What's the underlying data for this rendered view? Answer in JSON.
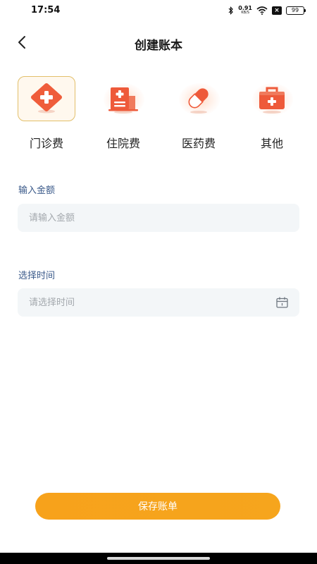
{
  "status_bar": {
    "time": "17:54",
    "net_speed": "0.91",
    "net_unit": "KB/S",
    "battery": "99"
  },
  "header": {
    "title": "创建账本",
    "back_icon": "chevron-left-icon"
  },
  "categories": [
    {
      "label": "门诊费",
      "icon": "medical-cross-icon",
      "selected": true
    },
    {
      "label": "住院费",
      "icon": "hospital-building-icon",
      "selected": false
    },
    {
      "label": "医药费",
      "icon": "pill-capsule-icon",
      "selected": false
    },
    {
      "label": "其他",
      "icon": "first-aid-kit-icon",
      "selected": false
    }
  ],
  "form": {
    "amount": {
      "label": "输入金额",
      "placeholder": "请输入金额",
      "value": ""
    },
    "time": {
      "label": "选择时间",
      "placeholder": "请选择时间",
      "value": "",
      "icon": "calendar-icon"
    }
  },
  "actions": {
    "save_label": "保存账单"
  },
  "colors": {
    "accent": "#F7A21B",
    "icon_red": "#EE5A3A",
    "label_blue": "#3B5A8A",
    "selected_border": "#E2BF6A"
  }
}
